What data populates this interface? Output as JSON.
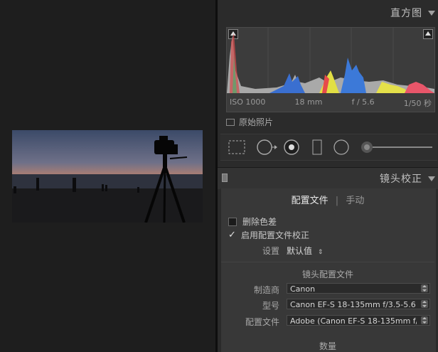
{
  "histogram": {
    "title": "直方图",
    "iso": "ISO 1000",
    "focal": "18 mm",
    "aperture": "f / 5.6",
    "shutter": "1/50 秒",
    "original_photo_label": "原始照片"
  },
  "lens_correction": {
    "title": "镜头校正",
    "tabs": [
      "配置文件",
      "手动"
    ],
    "remove_ca_label": "删除色差",
    "remove_ca_checked": false,
    "enable_profile_label": "启用配置文件校正",
    "enable_profile_checked": true,
    "setup_label": "设置",
    "setup_value": "默认值",
    "lens_profile_section": "镜头配置文件",
    "make_label": "制造商",
    "make_value": "Canon",
    "model_label": "型号",
    "model_value": "Canon EF-S 18-135mm f/3.5-5.6 I...",
    "profile_label": "配置文件",
    "profile_value": "Adobe (Canon EF-S 18-135mm f/...",
    "amount_label": "数量"
  },
  "colors": {
    "panel_bg": "#2b2b2b",
    "canvas_bg": "#1e1e1e",
    "text": "#c8c8c8"
  }
}
